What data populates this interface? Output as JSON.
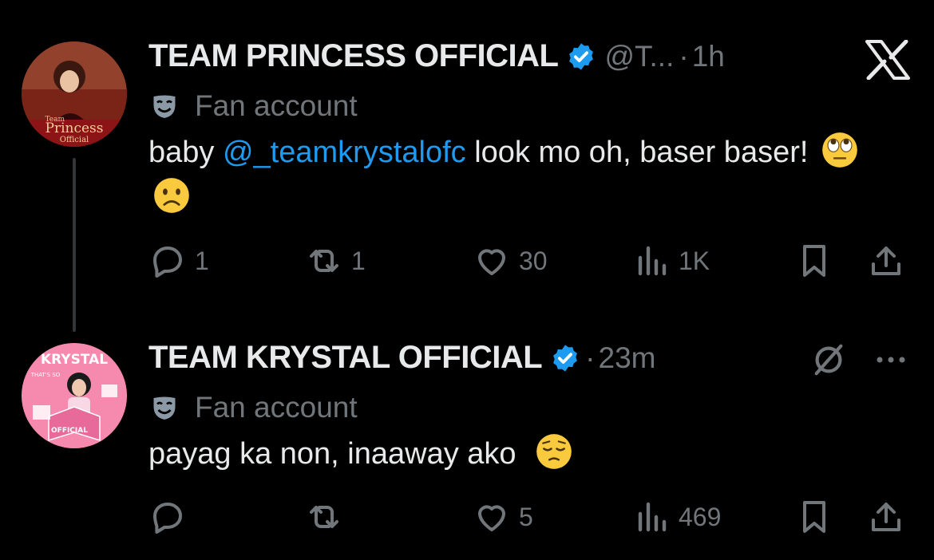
{
  "tweets": [
    {
      "name": "TEAM PRINCESS OFFICIAL",
      "handle": "@T...",
      "time": "1h",
      "label": "Fan account",
      "text_before": "baby ",
      "mention": "@_teamkrystalofc",
      "text_after": " look mo oh, baser baser!",
      "emojis": [
        "face-with-rolling-eyes",
        "frowning-face"
      ],
      "avatar_text": [
        "Team",
        "Princess",
        "Official"
      ],
      "stats": {
        "replies": "1",
        "reposts": "1",
        "likes": "30",
        "views": "1K"
      }
    },
    {
      "name": "TEAM KRYSTAL OFFICIAL",
      "time": "23m",
      "label": "Fan account",
      "text": "payag ka non, inaaway ako",
      "emojis": [
        "pensive-face"
      ],
      "avatar_text": [
        "KRYSTAL",
        "THAT'S SO",
        "OFFICIAL"
      ],
      "stats": {
        "replies": "",
        "reposts": "",
        "likes": "5",
        "views": "469"
      }
    }
  ],
  "icons": [
    "x-logo-icon",
    "verified-badge-icon",
    "mask-icon",
    "reply-icon",
    "repost-icon",
    "like-icon",
    "views-icon",
    "bookmark-icon",
    "share-icon",
    "mute-icon",
    "more-icon"
  ],
  "colors": {
    "background": "#000000",
    "text": "#e7e9ea",
    "secondary": "#71767b",
    "accent": "#1d9bf0",
    "thread_line": "#333639"
  }
}
